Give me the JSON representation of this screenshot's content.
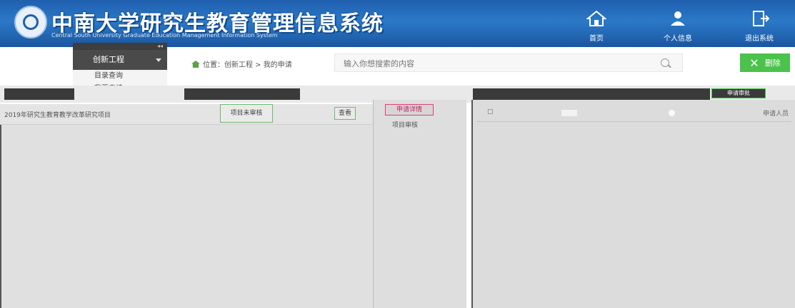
{
  "header": {
    "title": "中南大学研究生教育管理信息系统",
    "subtitle": "Central South University Graduate Education Management Information System",
    "nav": [
      {
        "label": "首页",
        "icon": "home-icon"
      },
      {
        "label": "个人信息",
        "icon": "person-icon"
      },
      {
        "label": "退出系统",
        "icon": "exit-icon"
      }
    ]
  },
  "sidebar": {
    "collapse_label": "◂◂",
    "group_label": "创新工程",
    "items": [
      {
        "label": "目录查询"
      },
      {
        "label": "我要申请"
      }
    ]
  },
  "breadcrumb": {
    "text": "位置：创新工程 > 我的申请"
  },
  "search": {
    "placeholder": "输入你想搜索的内容"
  },
  "toolbar": {
    "delete_label": "删除"
  },
  "table": {
    "row_text": "2019年研究生教育教学改革研究项目",
    "status_label": "项目未审核",
    "view_label": "查看"
  },
  "middle": {
    "tab_selected": "申请详情",
    "tab_other": "项目审核"
  },
  "right": {
    "header_tab": "申请审批",
    "row_end": "申请人员"
  }
}
